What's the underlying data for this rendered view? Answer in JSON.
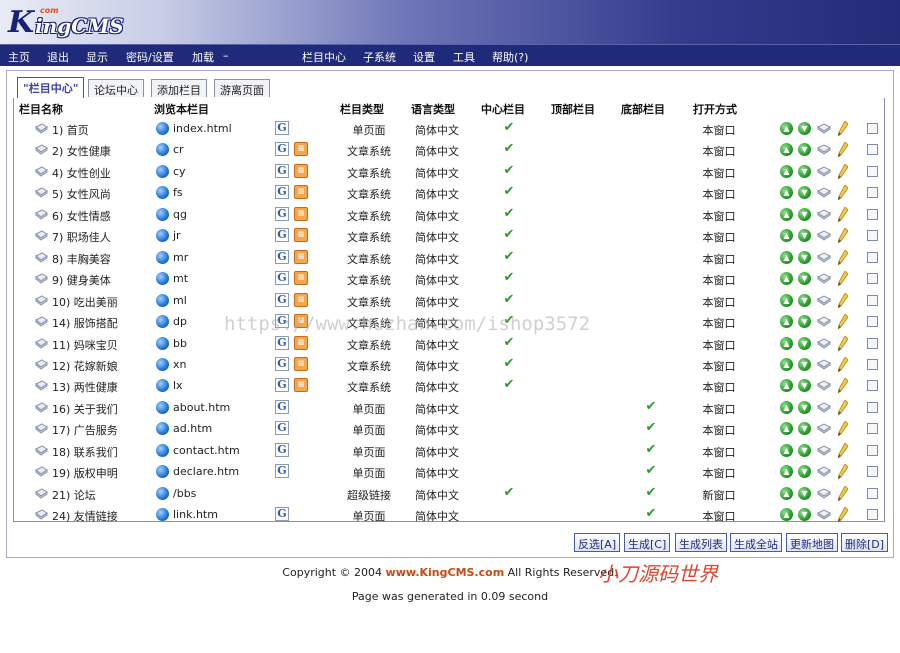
{
  "logo": {
    "k": "K",
    "rest": "ingCMS",
    "sup": "com"
  },
  "menu": {
    "left": [
      "主页",
      "退出",
      "显示",
      "密码/设置",
      "加载",
      "–"
    ],
    "right": [
      "栏目中心",
      "子系统",
      "设置",
      "工具",
      "帮助(?)"
    ]
  },
  "tabs": [
    "\"栏目中心\"",
    "论坛中心",
    "添加栏目",
    "游离页面"
  ],
  "columns": {
    "name": "栏目名称",
    "browse": "浏览本栏目",
    "type": "栏目类型",
    "lang": "语言类型",
    "center": "中心栏目",
    "top": "顶部栏目",
    "bottom": "底部栏目",
    "open": "打开方式"
  },
  "rows": [
    {
      "name": "1) 首页",
      "path": "index.html",
      "rss": false,
      "type": "单页面",
      "lang": "简体中文",
      "center": true,
      "bottom": false,
      "open": "本窗口"
    },
    {
      "name": "2) 女性健康",
      "path": "cr",
      "rss": true,
      "type": "文章系统",
      "lang": "简体中文",
      "center": true,
      "bottom": false,
      "open": "本窗口"
    },
    {
      "name": "4) 女性创业",
      "path": "cy",
      "rss": true,
      "type": "文章系统",
      "lang": "简体中文",
      "center": true,
      "bottom": false,
      "open": "本窗口"
    },
    {
      "name": "5) 女性风尚",
      "path": "fs",
      "rss": true,
      "type": "文章系统",
      "lang": "简体中文",
      "center": true,
      "bottom": false,
      "open": "本窗口"
    },
    {
      "name": "6) 女性情感",
      "path": "qg",
      "rss": true,
      "type": "文章系统",
      "lang": "简体中文",
      "center": true,
      "bottom": false,
      "open": "本窗口"
    },
    {
      "name": "7) 职场佳人",
      "path": "jr",
      "rss": true,
      "type": "文章系统",
      "lang": "简体中文",
      "center": true,
      "bottom": false,
      "open": "本窗口"
    },
    {
      "name": "8) 丰胸美容",
      "path": "mr",
      "rss": true,
      "type": "文章系统",
      "lang": "简体中文",
      "center": true,
      "bottom": false,
      "open": "本窗口"
    },
    {
      "name": "9) 健身美体",
      "path": "mt",
      "rss": true,
      "type": "文章系统",
      "lang": "简体中文",
      "center": true,
      "bottom": false,
      "open": "本窗口"
    },
    {
      "name": "10) 吃出美丽",
      "path": "ml",
      "rss": true,
      "type": "文章系统",
      "lang": "简体中文",
      "center": true,
      "bottom": false,
      "open": "本窗口"
    },
    {
      "name": "14) 服饰搭配",
      "path": "dp",
      "rss": true,
      "type": "文章系统",
      "lang": "简体中文",
      "center": true,
      "bottom": false,
      "open": "本窗口"
    },
    {
      "name": "11) 妈咪宝贝",
      "path": "bb",
      "rss": true,
      "type": "文章系统",
      "lang": "简体中文",
      "center": true,
      "bottom": false,
      "open": "本窗口"
    },
    {
      "name": "12) 花嫁新娘",
      "path": "xn",
      "rss": true,
      "type": "文章系统",
      "lang": "简体中文",
      "center": true,
      "bottom": false,
      "open": "本窗口"
    },
    {
      "name": "13) 两性健康",
      "path": "lx",
      "rss": true,
      "type": "文章系统",
      "lang": "简体中文",
      "center": true,
      "bottom": false,
      "open": "本窗口"
    },
    {
      "name": "16) 关于我们",
      "path": "about.htm",
      "rss": false,
      "type": "单页面",
      "lang": "简体中文",
      "center": false,
      "bottom": true,
      "open": "本窗口"
    },
    {
      "name": "17) 广告服务",
      "path": "ad.htm",
      "rss": false,
      "type": "单页面",
      "lang": "简体中文",
      "center": false,
      "bottom": true,
      "open": "本窗口"
    },
    {
      "name": "18) 联系我们",
      "path": "contact.htm",
      "rss": false,
      "type": "单页面",
      "lang": "简体中文",
      "center": false,
      "bottom": true,
      "open": "本窗口"
    },
    {
      "name": "19) 版权申明",
      "path": "declare.htm",
      "rss": false,
      "type": "单页面",
      "lang": "简体中文",
      "center": false,
      "bottom": true,
      "open": "本窗口"
    },
    {
      "name": "21) 论坛",
      "path": "/bbs",
      "rss": false,
      "type": "超级链接",
      "lang": "简体中文",
      "center": true,
      "bottom": true,
      "open": "新窗口",
      "noG": true
    },
    {
      "name": "24) 友情链接",
      "path": "link.htm",
      "rss": false,
      "type": "单页面",
      "lang": "简体中文",
      "center": false,
      "bottom": true,
      "open": "本窗口"
    }
  ],
  "actions": [
    "反选[A]",
    "生成[C]",
    "生成列表",
    "生成全站",
    "更新地图",
    "删除[D]"
  ],
  "footer": {
    "copyright_prefix": "Copyright © 2004 ",
    "brand": "www.KingCMS.com",
    "copyright_suffix": " All Rights Reserved.",
    "generated": "Page was generated in 0.09 second"
  },
  "watermark": "https://www.huzhan.com/ishop3572",
  "signature": "小刀源码世界",
  "colors": {
    "header_dark": "#242b78",
    "menubar": "#202a7a",
    "check_green": "#2e9a2e",
    "brand": "#c84a10"
  }
}
